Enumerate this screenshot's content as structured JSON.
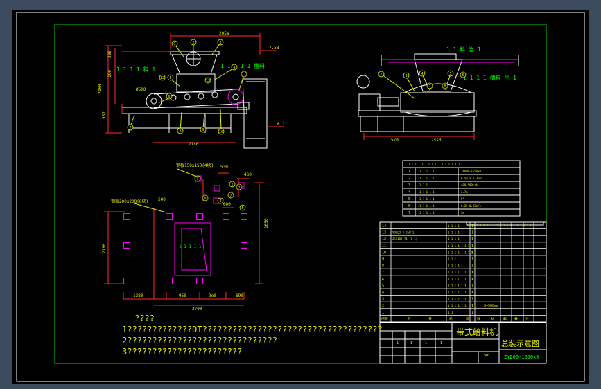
{
  "colors": {
    "viewport_bg": "#3b4a5d",
    "sheet_bg": "#000000",
    "border": "#ffffff",
    "frame": "#00d000",
    "geometry": "#ffffff",
    "dim": "#ff2a2a",
    "accent_magenta": "#ff00ff",
    "label": "#e8f000",
    "callout": "#00ff00"
  },
  "drawing": {
    "front_view": {
      "dim_top": "205s",
      "dim_width": "27s0",
      "dim_height": "2460",
      "dim_left_1": "200",
      "dim_left_2": "190",
      "dim_left_3": "587",
      "dim_roller": "Ø500",
      "level_top": "7.58",
      "level_bottom": "6.1",
      "label_left": "1 1 1 1 料 1",
      "label_right": "1 1 1 1 1 槽料",
      "balloons": [
        "1",
        "2",
        "3",
        "4",
        "5",
        "6",
        "7",
        "8",
        "9",
        "10",
        "11",
        "12",
        "13"
      ]
    },
    "side_view": {
      "label_top": "1 1 料 当 1",
      "label_right": "1 1 1 1 槽料 用 1",
      "dim_left": "570",
      "dim_right": "2ss0",
      "balloons": [
        "1",
        "3",
        "4",
        "5",
        "6",
        "7",
        "8"
      ]
    },
    "plan_view": {
      "label_top": "钢板150x150(4块)",
      "label_left": "钢板200x200(8块)",
      "dim_530": "530",
      "dim_460": "460",
      "dim_500": "500",
      "dim_600": "600",
      "dim_1650": "1650",
      "dim_2160": "2160",
      "dim_1380": "1380",
      "dim_950": "950",
      "dim_9e0": "9e0",
      "dim_690": "690",
      "dim_total": "2700",
      "center_text": "1 1 1 1 1",
      "balloons": [
        "1",
        "2",
        "3",
        "4",
        "5",
        "6",
        "7"
      ]
    },
    "tech_table": {
      "header": "1 1 1 1 1 1 1 1 1 1 1 1 1 1 1 1 1",
      "rows": [
        {
          "no": "1",
          "name": "1 1 1 1 1",
          "value": "ZYD00-1650x0"
        },
        {
          "no": "2",
          "name": "1 1 1 1 1 1",
          "value": "6.5m x 1.35m²"
        },
        {
          "no": "3",
          "name": "1 1 1 1",
          "value": "480-500t/h"
        },
        {
          "no": "4",
          "name": "1 1 1 1 1",
          "value": "2.7m"
        },
        {
          "no": "5",
          "name": "1 1 1 1 1",
          "value": "5°"
        },
        {
          "no": "6",
          "name": "1 1 1 1 1",
          "value": "0.25~0.32m/s"
        },
        {
          "no": "7",
          "name": "1 1 1 1 1",
          "value": "5m"
        }
      ]
    },
    "note_box": "1 1 1 1 1 1 1 1 1 1 1 1 1 1 1 1 1 1 1 1 1",
    "bom": {
      "header": {
        "no": "序号",
        "code": "代",
        "name": "号",
        "cat": "名",
        "qty": "称",
        "weight": "数",
        "mat": "材",
        "note": "料",
        "c9": "备",
        "c10": "注"
      },
      "rows": [
        {
          "no": "14",
          "code": "",
          "name": "1 1 1 1",
          "qty": "1"
        },
        {
          "no": "13",
          "code": "Y90L2-4-2kW 1",
          "name": "1 1 1 1 1",
          "qty": "1"
        },
        {
          "no": "12",
          "code": "ZSX180-71 (1 1)",
          "name": "1 1 1 1",
          "qty": "1"
        },
        {
          "no": "11",
          "code": "",
          "name": "1 1 1 1 1 1 1",
          "qty": "1"
        },
        {
          "no": "10",
          "code": "",
          "name": "1 1 1 1 1 1 1 1",
          "qty": "1"
        },
        {
          "no": "9",
          "code": "",
          "name": "1 1 1",
          "qty": "1"
        },
        {
          "no": "8",
          "code": "",
          "name": "1 1 1 1 1",
          "qty": "1"
        },
        {
          "no": "7",
          "code": "",
          "name": "1 1 1 1 1 1 1 1",
          "qty": "1"
        },
        {
          "no": "6",
          "code": "",
          "name": "1 1 1 1 1 1 1 1",
          "qty": "1"
        },
        {
          "no": "5",
          "code": "",
          "name": "1 1 1 1 1 1",
          "qty": "1"
        },
        {
          "no": "4",
          "code": "",
          "name": "1 1 1 1 1 1 1 1",
          "qty": "1"
        },
        {
          "no": "3",
          "code": "",
          "name": "1 1 1 1 1 1 1",
          "qty": "1"
        },
        {
          "no": "2",
          "code": "",
          "name": "1 1 1 1 1 1",
          "qty": "1",
          "note": "S=500mm"
        },
        {
          "no": "1",
          "code": "",
          "name": "1 1",
          "qty": "1"
        }
      ]
    },
    "title_block": {
      "title_left": "带式给料机",
      "title_right": "总装示意图",
      "drawing_no": "ZYD00-1650x0",
      "scale_label": "1:40",
      "sheet_cells": [
        "1",
        "1",
        "1",
        "1"
      ]
    },
    "notes": {
      "heading": "????",
      "line1": "1?????????????DT????????????????????????????????????",
      "line2": "2??????????????????????????????",
      "line3": "3???????????????????????"
    }
  }
}
